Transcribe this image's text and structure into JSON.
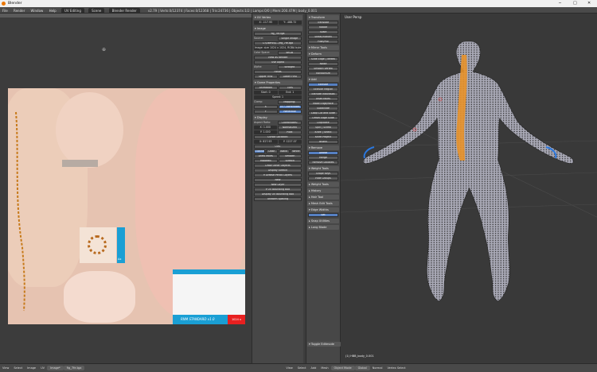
{
  "window": {
    "title": "Blender",
    "min": "─",
    "max": "□",
    "close": "✕"
  },
  "topbar": {
    "menus": [
      "File",
      "Render",
      "Window",
      "Help"
    ],
    "layout": "UV Editing",
    "scene": "Scene",
    "engine": "Blender Render",
    "stats": "v2.79 | Verts:0/12374 | Faces:0/12368 | Tris:24736 | Objects:1/2 | Lamps:0/0 | Mem:200.47M | body_0.001"
  },
  "npanel": {
    "sections": [
      {
        "title": "▾ UV Vertex",
        "rows": [
          [
            "X: -117.95",
            "Y: -488.72"
          ]
        ]
      },
      {
        "title": "▾ Image",
        "rows": [
          [
            "fig_7fe.tga"
          ],
          [
            "Source:",
            "Single Image"
          ],
          [
            "C:\\Users\\s\\...\\fig_7fe.tga"
          ],
          [
            "Image: size 1024 x 1024, RGBA byte"
          ],
          [
            "Color Space:",
            "sRGB"
          ],
          [
            "View as Render"
          ],
          [
            "Use Alpha"
          ],
          [
            "Alpha:",
            "Straight"
          ],
          [
            "Fields"
          ],
          [
            "Upper First",
            "Lower First"
          ]
        ]
      },
      {
        "title": "▾ Game Properties",
        "rows": [
          [
            "Animation",
            "Tiles"
          ],
          [
            "Start: 0",
            "End: 1"
          ],
          [
            "Speed: 1"
          ],
          [
            "Clamp:",
            "Mapping:"
          ],
          [
            "X",
            "UV Coordinates"
          ],
          [
            "Y",
            "Reflection"
          ]
        ]
      },
      {
        "title": "▾ Display",
        "rows": [
          [
            "Aspect Ratio:",
            "Coordinates:"
          ],
          [
            "X: 1.000",
            "Normalized"
          ],
          [
            "Y: 1.000",
            "Pixel"
          ],
          [
            "Cursor Location:"
          ],
          [
            "X: 827.93",
            "Y: 1227.07"
          ],
          [
            "UVs:"
          ],
          [
            "Outline",
            "Dash",
            "Black",
            "White"
          ],
          [
            "Draw Faces",
            "Smooth"
          ],
          [
            "Modified",
            "Stretch"
          ],
          [
            "Draw Other Objects"
          ],
          [
            "Display Stretch"
          ],
          [
            "▾ Grease Pencil Layers"
          ],
          [
            "New"
          ],
          [
            "New Layer"
          ],
          [
            "▾ UV Bounding Box"
          ],
          [
            "Display UV Bounding Box"
          ],
          [
            "Uniform Spacing"
          ]
        ]
      }
    ]
  },
  "tpanel": {
    "sections": [
      {
        "title": "▾ Transform",
        "rows": [
          "Translate",
          "Rotate",
          "Scale",
          "Shear/Flatten",
          "Push/Pull"
        ]
      },
      {
        "title": "▾ Mirror Tools",
        "rows": []
      },
      {
        "title": "▾ Deform",
        "rows": [
          "Slide Edge | Vertex",
          "Noise",
          "Smooth Vertex",
          "Randomize"
        ]
      },
      {
        "title": "▾ Add",
        "rows": [
          "Extrude",
          "Extrude Region",
          "Extrude Individual",
          "Inset Faces",
          "Make Edge/Face",
          "Subdivide",
          "Loop Cut and Slide",
          "Offset Edge Slide",
          "Duplicate",
          "Spin | Screw",
          "Knife | Select",
          "Knife Project",
          "Bisect"
        ]
      },
      {
        "title": "▾ Remove",
        "rows": [
          "Delete",
          "Merge",
          "Remove Doubles"
        ]
      },
      {
        "title": "▾ Weight Tools",
        "rows": [
          "Shape Keys",
          "Hide Groups"
        ]
      },
      {
        "title": "▸ Weight Tools",
        "rows": []
      },
      {
        "title": "▸ History",
        "rows": []
      },
      {
        "title": "▸ Hair Tool",
        "rows": []
      },
      {
        "title": "▸ Mesh Edit Tools",
        "rows": []
      },
      {
        "title": "▾ Edge Widths",
        "rows": [
          "Set"
        ]
      },
      {
        "title": "▸ Snap Utilities",
        "rows": []
      },
      {
        "title": "▸ Long Blade",
        "rows": []
      }
    ],
    "footer": "▾ Toggle Editmode"
  },
  "uv": {
    "badge": "Ax",
    "texture_label": "RNM STANDARD v1.0",
    "size_label": "1024 x 1024"
  },
  "view3d": {
    "label": "User Persp",
    "footer": "(1) HBB_body_0.001"
  },
  "footbar": {
    "items": [
      "View",
      "Select",
      "Image",
      "UV",
      "Image*",
      "fig_7fe.tga",
      "View",
      "Select",
      "Add",
      "Mesh",
      "Object Mode",
      "Global",
      "Normal",
      "Vertex Select"
    ]
  },
  "colors": {
    "accent": "#5680c2",
    "mesh": "#2b2b2b",
    "orange": "#e8922a"
  }
}
